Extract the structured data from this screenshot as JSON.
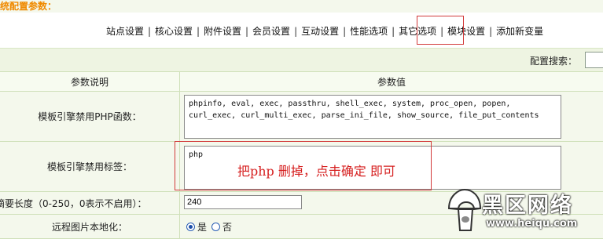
{
  "header": {
    "title": "统配置参数："
  },
  "tabs": [
    {
      "label": "站点设置"
    },
    {
      "label": "核心设置"
    },
    {
      "label": "附件设置"
    },
    {
      "label": "会员设置"
    },
    {
      "label": "互动设置"
    },
    {
      "label": "性能选项"
    },
    {
      "label": "其它选项"
    },
    {
      "label": "模块设置"
    },
    {
      "label": "添加新变量"
    }
  ],
  "search": {
    "label": "配置搜索：",
    "value": ""
  },
  "table": {
    "col_param": "参数说明",
    "col_value": "参数值",
    "rows": [
      {
        "label": "模板引擎禁用PHP函数：",
        "value": "phpinfo, eval, exec, passthru, shell_exec, system, proc_open, popen, curl_exec, curl_multi_exec, parse_ini_file, show_source, file_put_contents"
      },
      {
        "label": "模板引擎禁用标签：",
        "value": "php"
      },
      {
        "label": "摘要长度（0-250，0表示不启用）：",
        "value": "240"
      },
      {
        "label": "远程图片本地化：",
        "options": [
          {
            "label": "是",
            "checked": true
          },
          {
            "label": "否",
            "checked": false
          }
        ]
      }
    ]
  },
  "annotation": {
    "text": "把php 删掉，点击确定 即可"
  },
  "watermark": {
    "title": "黑区网络",
    "url": "www.heiqu.com"
  },
  "colors": {
    "title": "#f08a00",
    "accent_red": "#d23a3a",
    "row_bg": "#f4f8ec",
    "border": "#cfe0b9"
  }
}
